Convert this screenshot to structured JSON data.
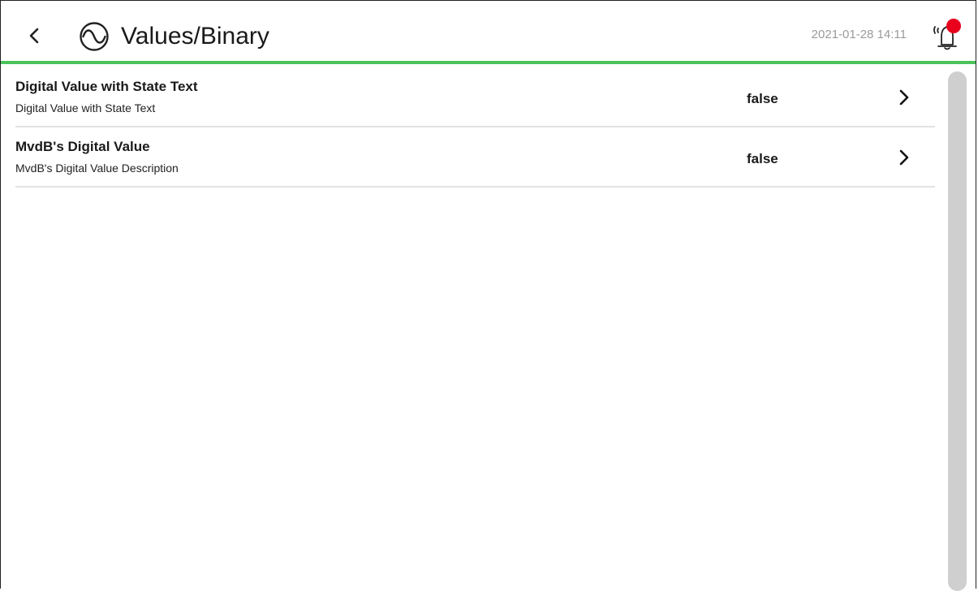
{
  "header": {
    "title": "Values/Binary",
    "datetime": "2021-01-28 14:11",
    "icons": {
      "back": "chevron-left-icon",
      "app": "sine-wave-icon",
      "alarm": "alarm-bell-icon"
    },
    "accent_color": "#4cc25a",
    "alarm_badge_color": "#e8001c"
  },
  "items": [
    {
      "title": "Digital Value with State Text",
      "subtitle": "Digital Value with State Text",
      "value": "false"
    },
    {
      "title": "MvdB's Digital Value",
      "subtitle": "MvdB's Digital Value Description",
      "value": "false"
    }
  ]
}
